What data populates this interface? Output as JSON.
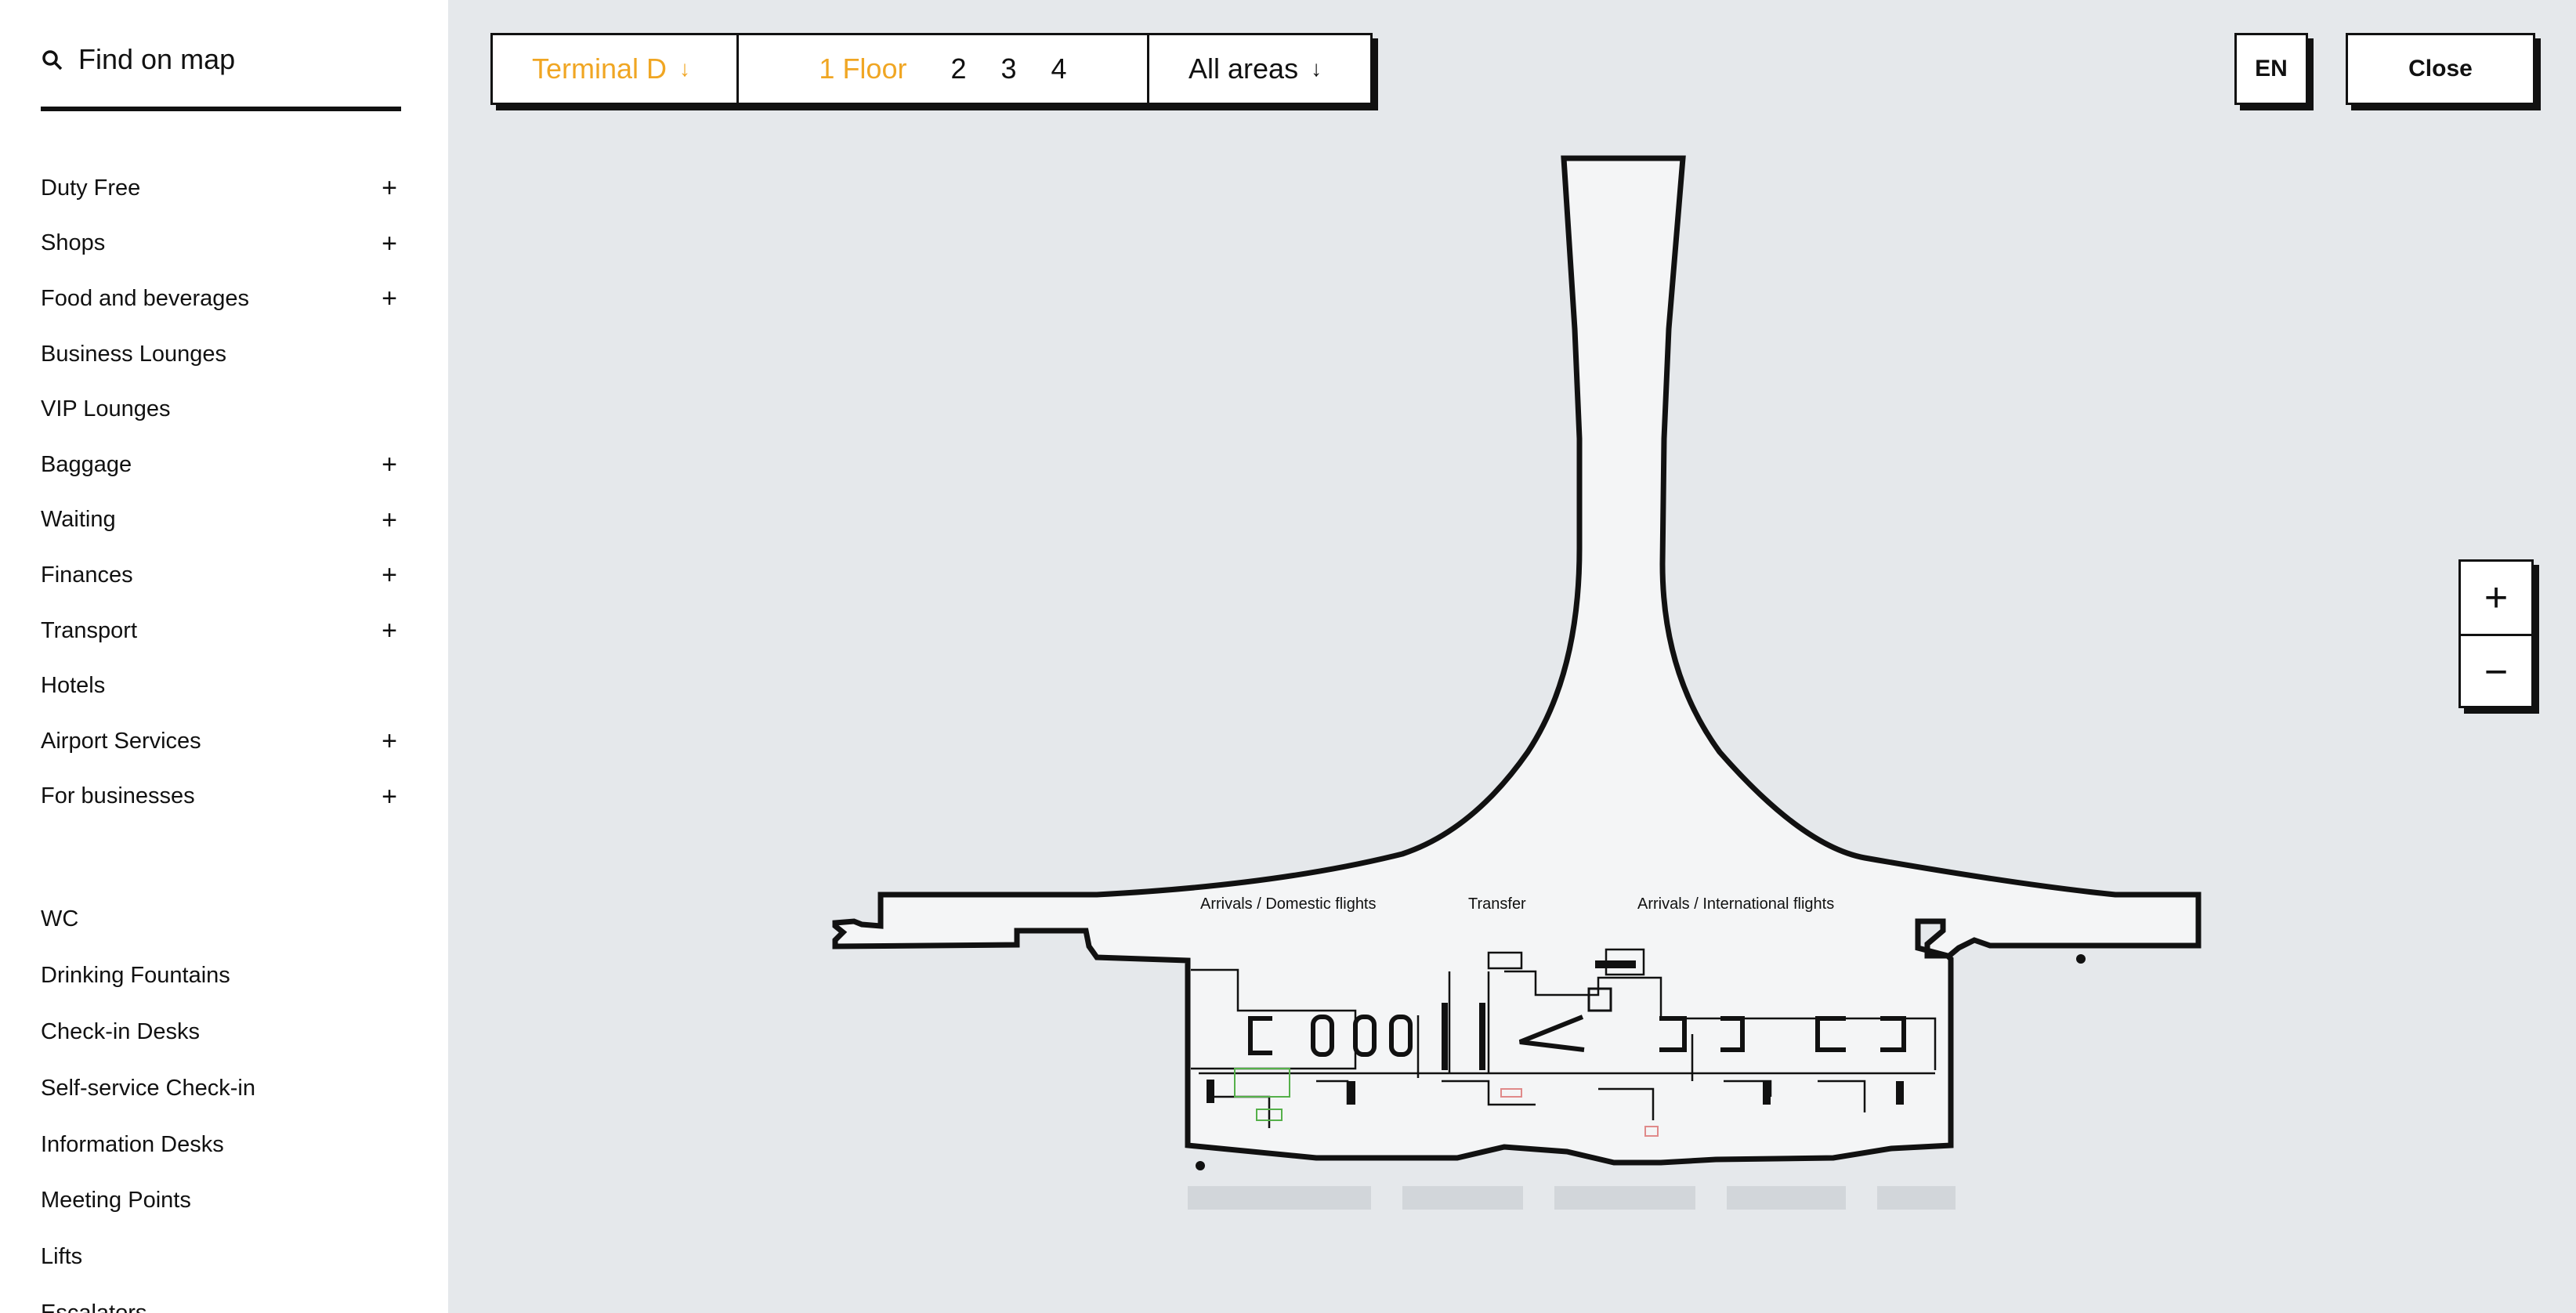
{
  "search": {
    "label": "Find on map",
    "icon": "search-icon"
  },
  "categories": [
    {
      "label": "Duty Free",
      "expandable": true
    },
    {
      "label": "Shops",
      "expandable": true
    },
    {
      "label": "Food and beverages",
      "expandable": true
    },
    {
      "label": "Business Lounges",
      "expandable": false
    },
    {
      "label": "VIP Lounges",
      "expandable": false
    },
    {
      "label": "Baggage",
      "expandable": true
    },
    {
      "label": "Waiting",
      "expandable": true
    },
    {
      "label": "Finances",
      "expandable": true
    },
    {
      "label": "Transport",
      "expandable": true
    },
    {
      "label": "Hotels",
      "expandable": false
    },
    {
      "label": "Airport Services",
      "expandable": true
    },
    {
      "label": "For businesses",
      "expandable": true
    }
  ],
  "facilities": [
    {
      "label": "WC"
    },
    {
      "label": "Drinking Fountains"
    },
    {
      "label": "Check-in Desks"
    },
    {
      "label": "Self-service Check-in"
    },
    {
      "label": "Information Desks"
    },
    {
      "label": "Meeting Points"
    },
    {
      "label": "Lifts"
    },
    {
      "label": "Escalators"
    }
  ],
  "expand_glyph": "+",
  "toolbar": {
    "terminal": "Terminal D",
    "arrow": "↓",
    "floors": [
      {
        "label": "1 Floor",
        "active": true
      },
      {
        "label": "2",
        "active": false
      },
      {
        "label": "3",
        "active": false
      },
      {
        "label": "4",
        "active": false
      }
    ],
    "areas": "All areas"
  },
  "lang": "EN",
  "close": "Close",
  "zoom": {
    "in": "+",
    "out": "−"
  },
  "map": {
    "labels": {
      "domestic": "Arrivals / Domestic flights",
      "transfer": "Transfer",
      "international": "Arrivals / International flights"
    }
  },
  "colors": {
    "accent": "#f0a623",
    "background": "#e5e8eb",
    "building_fill": "#f4f5f6"
  }
}
